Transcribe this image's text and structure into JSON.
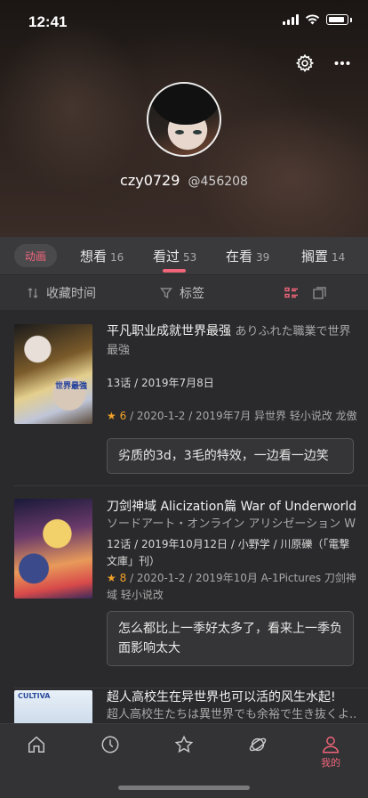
{
  "status_bar": {
    "time": "12:41"
  },
  "profile": {
    "username": "czy0729",
    "user_id": "@456208"
  },
  "tabs": {
    "type_label": "动画",
    "items": [
      {
        "label": "想看",
        "count": "16"
      },
      {
        "label": "看过",
        "count": "53",
        "active": true
      },
      {
        "label": "在看",
        "count": "39"
      },
      {
        "label": "搁置",
        "count": "14"
      }
    ]
  },
  "filters": {
    "sort_label": "收藏时间",
    "tag_label": "标签"
  },
  "items": [
    {
      "title": "平凡职业成就世界最强",
      "title_jp": "ありふれた職業で世界最強",
      "info": "13话 / 2019年7月8日",
      "score": "6",
      "detail": "/ 2020-1-2 / 2019年7月 异世界 轻小说改 龙傲天",
      "comment": "劣质的3d，3毛的特效，一边看一边笑"
    },
    {
      "title": "刀剑神域 Alicization篇 War of Underworld",
      "title_jp": "ソードアート・オンライン アリシゼーション W...",
      "info": "12话 / 2019年10月12日 / 小野学 / 川原礫（「電撃文庫」刊）",
      "score": "8",
      "detail": "/ 2020-1-2 / 2019年10月 A-1Pictures 刀剑神域 轻小说改",
      "comment": "怎么都比上一季好太多了，看来上一季负面影响太大"
    },
    {
      "title": "超人高校生在异世界也可以活的风生水起!",
      "title_jp": "超人高校生たちは異世界でも余裕で生き抜くよ..."
    }
  ],
  "cover_text": {
    "item1": "世界最強",
    "item3": "CULTIVA"
  },
  "bottom_nav": {
    "items": [
      {
        "icon": "home-icon"
      },
      {
        "icon": "clock-icon"
      },
      {
        "icon": "star-icon"
      },
      {
        "icon": "planet-icon"
      },
      {
        "icon": "user-icon",
        "label": "我的",
        "active": true
      }
    ]
  },
  "colors": {
    "accent": "#f0657a",
    "star": "#f2a228"
  }
}
